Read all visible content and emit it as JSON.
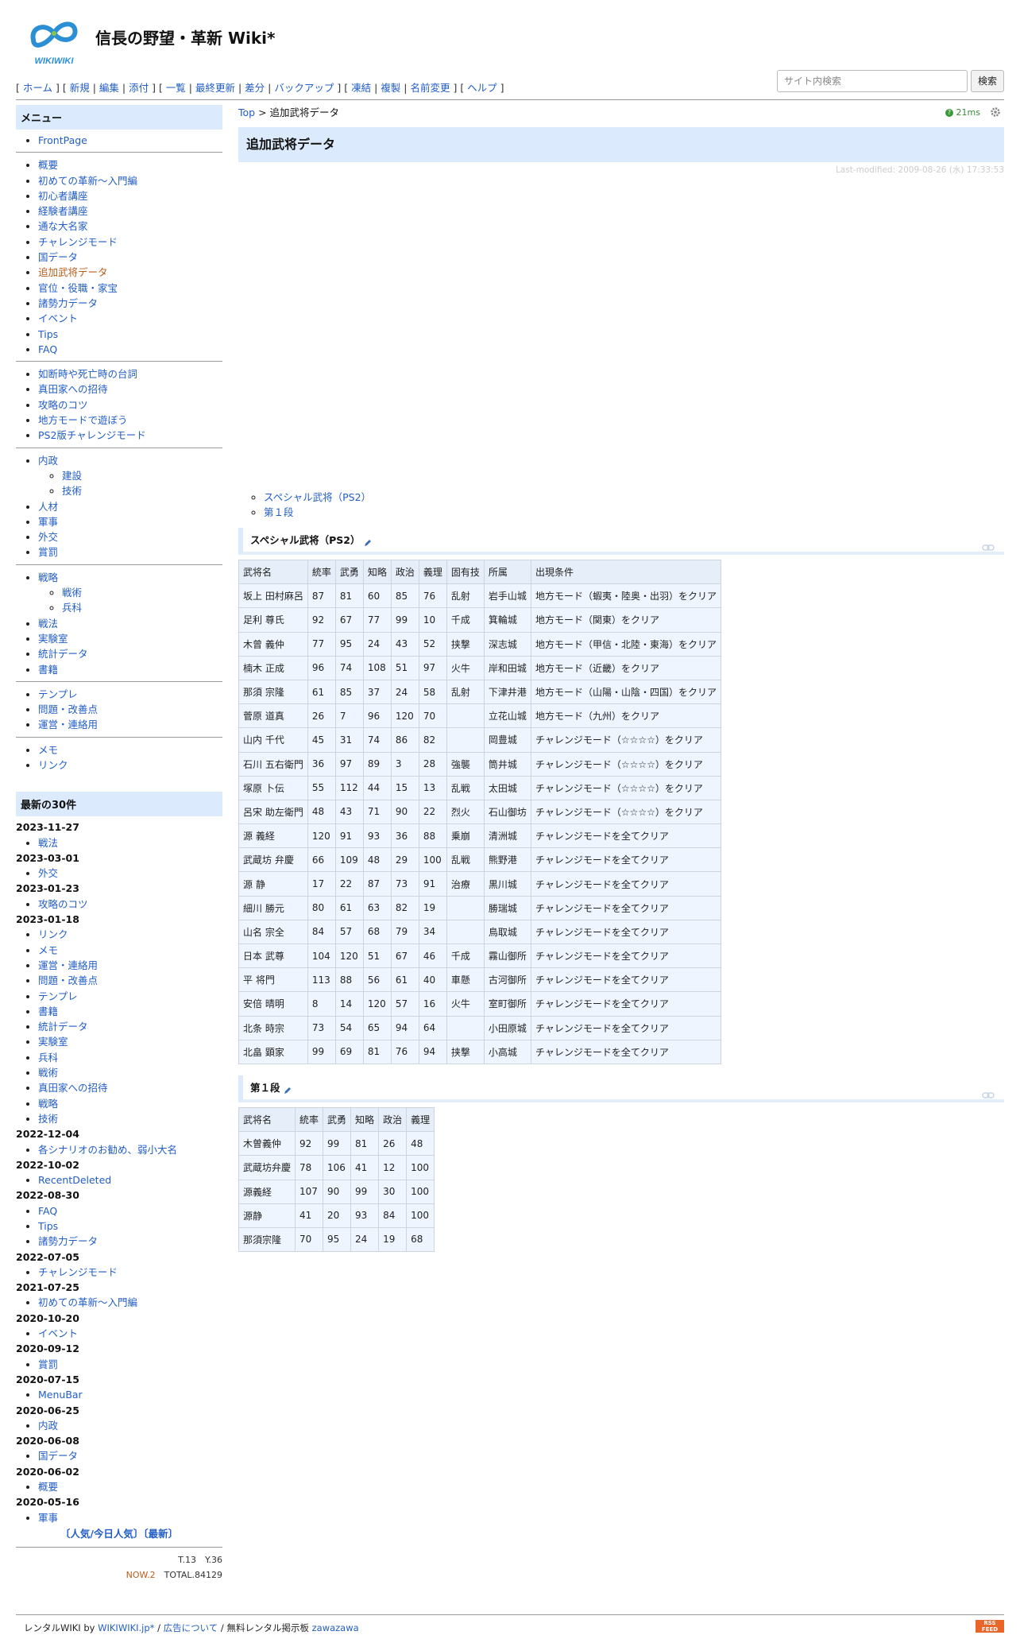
{
  "site": {
    "title": "信長の野望・革新 Wiki*",
    "logo_text": "WIKIWIKI"
  },
  "nav": {
    "groups": [
      [
        "ホーム"
      ],
      [
        "新規",
        "編集",
        "添付"
      ],
      [
        "一覧",
        "最終更新",
        "差分",
        "バックアップ"
      ],
      [
        "凍結",
        "複製",
        "名前変更"
      ],
      [
        "ヘルプ"
      ]
    ]
  },
  "search": {
    "placeholder": "サイト内検索",
    "button": "検索"
  },
  "sidebar": {
    "menu_title": "メニュー",
    "frontpage": "FrontPage",
    "group1": [
      "概要",
      "初めての革新〜入門編",
      "初心者講座",
      "経験者講座",
      "通な大名家",
      "チャレンジモード",
      "国データ",
      "追加武将データ",
      "官位・役職・家宝",
      "諸勢力データ",
      "イベント",
      "Tips",
      "FAQ"
    ],
    "group2": [
      "如断時や死亡時の台詞",
      "真田家への招待",
      "攻略のコツ",
      "地方モードで遊ぼう",
      "PS2版チャレンジモード"
    ],
    "group3": [
      {
        "label": "内政",
        "sub": [
          "建設",
          "技術"
        ]
      },
      {
        "label": "人材",
        "sub": []
      },
      {
        "label": "軍事",
        "sub": []
      },
      {
        "label": "外交",
        "sub": []
      },
      {
        "label": "賞罰",
        "sub": []
      }
    ],
    "group4": [
      {
        "label": "戦略",
        "sub": [
          "戦術",
          "兵科"
        ]
      },
      {
        "label": "戦法",
        "sub": []
      },
      {
        "label": "実験室",
        "sub": []
      },
      {
        "label": "統計データ",
        "sub": []
      },
      {
        "label": "書籍",
        "sub": []
      }
    ],
    "group5": [
      "テンプレ",
      "問題・改善点",
      "運営・連絡用"
    ],
    "group6": [
      "メモ",
      "リンク"
    ],
    "recent_title": "最新の30件",
    "recent": [
      {
        "date": "2023-11-27",
        "pages": [
          "戦法"
        ]
      },
      {
        "date": "2023-03-01",
        "pages": [
          "外交"
        ]
      },
      {
        "date": "2023-01-23",
        "pages": [
          "攻略のコツ"
        ]
      },
      {
        "date": "2023-01-18",
        "pages": [
          "リンク",
          "メモ",
          "運営・連絡用",
          "問題・改善点",
          "テンプレ",
          "書籍",
          "統計データ",
          "実験室",
          "兵科",
          "戦術",
          "真田家への招待",
          "戦略",
          "技術"
        ]
      },
      {
        "date": "2022-12-04",
        "pages": [
          "各シナリオのお勧め、弱小大名"
        ]
      },
      {
        "date": "2022-10-02",
        "pages": [
          "RecentDeleted"
        ]
      },
      {
        "date": "2022-08-30",
        "pages": [
          "FAQ",
          "Tips",
          "諸勢力データ"
        ]
      },
      {
        "date": "2022-07-05",
        "pages": [
          "チャレンジモード"
        ]
      },
      {
        "date": "2021-07-25",
        "pages": [
          "初めての革新〜入門編"
        ]
      },
      {
        "date": "2020-10-20",
        "pages": [
          "イベント"
        ]
      },
      {
        "date": "2020-09-12",
        "pages": [
          "賞罰"
        ]
      },
      {
        "date": "2020-07-15",
        "pages": [
          "MenuBar"
        ]
      },
      {
        "date": "2020-06-25",
        "pages": [
          "内政"
        ]
      },
      {
        "date": "2020-06-08",
        "pages": [
          "国データ"
        ]
      },
      {
        "date": "2020-06-02",
        "pages": [
          "概要"
        ]
      },
      {
        "date": "2020-05-16",
        "pages": [
          "軍事"
        ]
      }
    ],
    "popular_link": "〔人気/今日人気〕",
    "newest_link": "〔最新〕",
    "counter_line1": "T.13　Y.36",
    "counter_now": "NOW.2",
    "counter_total": "TOTAL.84129"
  },
  "main": {
    "breadcrumb_top": "Top",
    "breadcrumb_sep": " > ",
    "breadcrumb_current": "追加武将データ",
    "timing": "21ms",
    "page_title": "追加武将データ",
    "last_modified": "Last-modified: 2009-08-26 (水) 17:33:53",
    "toc": [
      "スペシャル武将（PS2）",
      "第１段"
    ]
  },
  "special": {
    "heading": "スペシャル武将（PS2）",
    "headers": [
      "武将名",
      "統率",
      "武勇",
      "知略",
      "政治",
      "義理",
      "固有技",
      "所属",
      "出現条件"
    ],
    "rows": [
      [
        "坂上 田村麻呂",
        "87",
        "81",
        "60",
        "85",
        "76",
        "乱射",
        "岩手山城",
        "地方モード（蝦夷・陸奥・出羽）をクリア"
      ],
      [
        "足利 尊氏",
        "92",
        "67",
        "77",
        "99",
        "10",
        "千成",
        "箕輪城",
        "地方モード（関東）をクリア"
      ],
      [
        "木曾 義仲",
        "77",
        "95",
        "24",
        "43",
        "52",
        "挟撃",
        "深志城",
        "地方モード（甲信・北陸・東海）をクリア"
      ],
      [
        "楠木 正成",
        "96",
        "74",
        "108",
        "51",
        "97",
        "火牛",
        "岸和田城",
        "地方モード（近畿）をクリア"
      ],
      [
        "那須 宗隆",
        "61",
        "85",
        "37",
        "24",
        "58",
        "乱射",
        "下津井港",
        "地方モード（山陽・山陰・四国）をクリア"
      ],
      [
        "菅原 道真",
        "26",
        "7",
        "96",
        "120",
        "70",
        "",
        "立花山城",
        "地方モード（九州）をクリア"
      ],
      [
        "山内 千代",
        "45",
        "31",
        "74",
        "86",
        "82",
        "",
        "岡豊城",
        "チャレンジモード（☆☆☆☆）をクリア"
      ],
      [
        "石川 五右衛門",
        "36",
        "97",
        "89",
        "3",
        "28",
        "強襲",
        "筒井城",
        "チャレンジモード（☆☆☆☆）をクリア"
      ],
      [
        "塚原 卜伝",
        "55",
        "112",
        "44",
        "15",
        "13",
        "乱戦",
        "太田城",
        "チャレンジモード（☆☆☆☆）をクリア"
      ],
      [
        "呂宋 助左衛門",
        "48",
        "43",
        "71",
        "90",
        "22",
        "烈火",
        "石山御坊",
        "チャレンジモード（☆☆☆☆）をクリア"
      ],
      [
        "源 義経",
        "120",
        "91",
        "93",
        "36",
        "88",
        "乗崩",
        "清洲城",
        "チャレンジモードを全てクリア"
      ],
      [
        "武蔵坊 弁慶",
        "66",
        "109",
        "48",
        "29",
        "100",
        "乱戦",
        "熊野港",
        "チャレンジモードを全てクリア"
      ],
      [
        "源 静",
        "17",
        "22",
        "87",
        "73",
        "91",
        "治療",
        "黒川城",
        "チャレンジモードを全てクリア"
      ],
      [
        "細川 勝元",
        "80",
        "61",
        "63",
        "82",
        "19",
        "",
        "勝瑞城",
        "チャレンジモードを全てクリア"
      ],
      [
        "山名 宗全",
        "84",
        "57",
        "68",
        "79",
        "34",
        "",
        "鳥取城",
        "チャレンジモードを全てクリア"
      ],
      [
        "日本 武尊",
        "104",
        "120",
        "51",
        "67",
        "46",
        "千成",
        "霧山御所",
        "チャレンジモードを全てクリア"
      ],
      [
        "平 将門",
        "113",
        "88",
        "56",
        "61",
        "40",
        "車懸",
        "古河御所",
        "チャレンジモードを全てクリア"
      ],
      [
        "安倍 晴明",
        "8",
        "14",
        "120",
        "57",
        "16",
        "火牛",
        "室町御所",
        "チャレンジモードを全てクリア"
      ],
      [
        "北条 時宗",
        "73",
        "54",
        "65",
        "94",
        "64",
        "",
        "小田原城",
        "チャレンジモードを全てクリア"
      ],
      [
        "北畠 顕家",
        "99",
        "69",
        "81",
        "76",
        "94",
        "挟撃",
        "小高城",
        "チャレンジモードを全てクリア"
      ]
    ]
  },
  "first": {
    "heading": "第１段",
    "headers": [
      "武将名",
      "統率",
      "武勇",
      "知略",
      "政治",
      "義理"
    ],
    "rows": [
      [
        "木曽義仲",
        "92",
        "99",
        "81",
        "26",
        "48"
      ],
      [
        "武蔵坊弁慶",
        "78",
        "106",
        "41",
        "12",
        "100"
      ],
      [
        "源義経",
        "107",
        "90",
        "99",
        "30",
        "100"
      ],
      [
        "源静",
        "41",
        "20",
        "93",
        "84",
        "100"
      ],
      [
        "那須宗隆",
        "70",
        "95",
        "24",
        "19",
        "68"
      ]
    ]
  },
  "footer": {
    "prefix": "レンタルWIKI by ",
    "wikiwiki": "WIKIWIKI.jp*",
    "sep1": " / ",
    "ad_link": "広告について",
    "sep2": " / 無料レンタル掲示板 ",
    "zawazawa": "zawazawa",
    "rss_line1": "RSS",
    "rss_line2": "FEED"
  },
  "colors": {
    "link": "#215dc6",
    "current_page": "#b85c1a",
    "header_bg": "#dbeafc",
    "table_cell_bg": "#eef5ff"
  }
}
